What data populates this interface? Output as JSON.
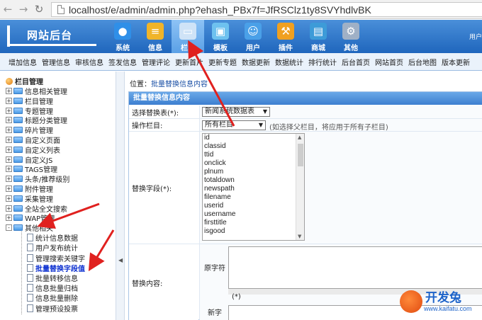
{
  "browser": {
    "url": "localhost/e/admin/admin.php?ehash_PBx7f=JfRSClz1ty8SVYhdlvBK"
  },
  "header": {
    "logo": "网站后台",
    "menu": [
      {
        "label": "系统",
        "icon": "globe-icon",
        "color": "#2f8fe8"
      },
      {
        "label": "信息",
        "icon": "document-icon",
        "color": "#f0b429"
      },
      {
        "label": "栏目",
        "icon": "folder-icon",
        "color": "#cfe3f7",
        "active": true
      },
      {
        "label": "模板",
        "icon": "window-icon",
        "color": "#6ec1ef"
      },
      {
        "label": "用户",
        "icon": "user-icon",
        "color": "#4aa0e8"
      },
      {
        "label": "插件",
        "icon": "tools-icon",
        "color": "#f0a020"
      },
      {
        "label": "商城",
        "icon": "shop-icon",
        "color": "#3d9bd8"
      },
      {
        "label": "其他",
        "icon": "gear-icon",
        "color": "#9fb0c6"
      }
    ],
    "user_text": "用户"
  },
  "submenu": [
    "增加信息",
    "管理信息",
    "审核信息",
    "签发信息",
    "管理评论",
    "更新首片",
    "更新专题",
    "数据更新",
    "数据统计",
    "排行统计",
    "后台首页",
    "网站首页",
    "后台地图",
    "版本更新"
  ],
  "sidebar": {
    "root": "栏目管理",
    "folders": [
      "信息相关管理",
      "栏目管理",
      "专题管理",
      "标题分类管理",
      "碎片管理",
      "自定义页面",
      "自定义列表",
      "自定义JS",
      "TAGS管理",
      "头条/推荐级别",
      "附件管理",
      "采集管理",
      "全站全文搜索",
      "WAP管理"
    ],
    "open_folder": "其他相关",
    "leaves": [
      "统计信息数据",
      "用户发布统计",
      "管理搜索关键字",
      "批量替换字段值",
      "批量转移信息",
      "信息批量归档",
      "信息批量删除",
      "管理预设投票"
    ],
    "active_leaf": "批量替换字段值"
  },
  "main": {
    "crumb_prefix": "位置：",
    "crumb_link": "批量替换信息内容",
    "form_title": "批量替换信息内容",
    "table_label": "选择替换表(*):",
    "table_value": "新闻系统数据表",
    "class_label": "操作栏目:",
    "class_value": "所有栏目",
    "class_hint": "(如选择父栏目，将应用于所有子栏目)",
    "field_label": "替换字段(*):",
    "fields": [
      "id",
      "classid",
      "ttid",
      "onclick",
      "plnum",
      "totaldown",
      "newspath",
      "filename",
      "userid",
      "username",
      "firsttitle",
      "isgood"
    ],
    "content_label": "替换内容:",
    "original_label": "原字符",
    "star": "(*)",
    "new_label": "新字"
  },
  "watermark": {
    "text": "开发兔",
    "url": "www.kaifatu.com"
  },
  "colors": {
    "header": "#2f74c9",
    "arrow": "#e0211f",
    "active_leaf": "#0b2fd0"
  }
}
